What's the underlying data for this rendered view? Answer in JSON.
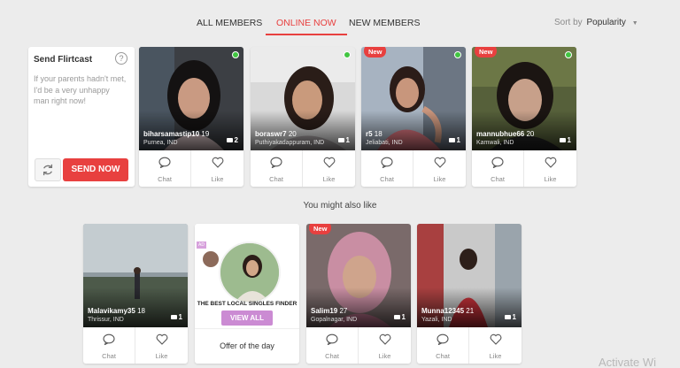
{
  "tabs": [
    {
      "label": "ALL MEMBERS",
      "active": false
    },
    {
      "label": "ONLINE NOW",
      "active": true
    },
    {
      "label": "NEW MEMBERS",
      "active": false
    }
  ],
  "sort": {
    "label": "Sort by",
    "value": "Popularity"
  },
  "flirt": {
    "title": "Send Flirtcast",
    "help_icon": "?",
    "message": "If your parents hadn't met, I'd be a very unhappy man right now!",
    "send_label": "SEND NOW"
  },
  "colors": {
    "accent": "#e8403f",
    "online": "#41c541",
    "ad_button": "#cb8bd3"
  },
  "members": [
    {
      "name": "biharsamastip10",
      "age": "19",
      "location": "Purnea, IND",
      "photos": "2",
      "online": true,
      "is_new": false,
      "chat": "Chat",
      "like": "Like"
    },
    {
      "name": "boraswr7",
      "age": "20",
      "location": "Puthiyakadappuram, IND",
      "photos": "1",
      "online": true,
      "is_new": false,
      "chat": "Chat",
      "like": "Like"
    },
    {
      "name": "r5",
      "age": "18",
      "location": "Jeliabati, IND",
      "photos": "1",
      "online": true,
      "is_new": true,
      "new_label": "New",
      "chat": "Chat",
      "like": "Like"
    },
    {
      "name": "mannubhue66",
      "age": "20",
      "location": "Kamwali, IND",
      "photos": "1",
      "online": true,
      "is_new": true,
      "new_label": "New",
      "chat": "Chat",
      "like": "Like"
    }
  ],
  "you_might_also_like": "You might also like",
  "suggested": [
    {
      "name": "Malavikamy35",
      "age": "18",
      "location": "Thrissur, IND",
      "photos": "1",
      "is_new": false,
      "chat": "Chat",
      "like": "Like"
    },
    {
      "name": "Salim19",
      "age": "27",
      "location": "Gopalnagar, IND",
      "photos": "1",
      "is_new": true,
      "new_label": "New",
      "chat": "Chat",
      "like": "Like"
    },
    {
      "name": "Munna12345",
      "age": "21",
      "location": "Yazali, IND",
      "photos": "1",
      "is_new": false,
      "chat": "Chat",
      "like": "Like"
    }
  ],
  "ad": {
    "tag": "AD",
    "headline": "THE BEST LOCAL SINGLES FINDER",
    "button": "VIEW ALL",
    "footer": "Offer of the day"
  },
  "watermark": "Activate Wi"
}
